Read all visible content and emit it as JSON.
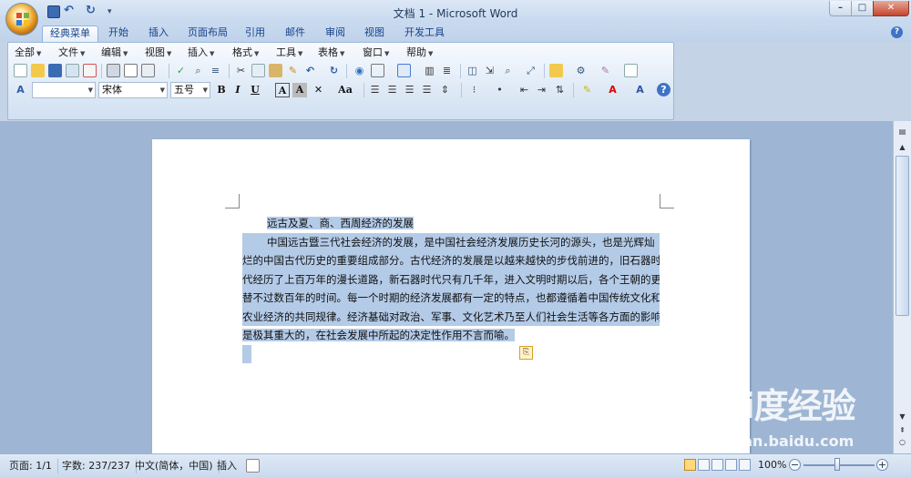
{
  "window": {
    "title": "文档 1 - Microsoft Word",
    "minimize": "–",
    "maximize": "□",
    "close": "✕"
  },
  "quick_access": {
    "undo": "↶",
    "redo": "↻",
    "more": "▾"
  },
  "tabs": [
    {
      "label": "经典菜单",
      "active": true
    },
    {
      "label": "开始"
    },
    {
      "label": "插入"
    },
    {
      "label": "页面布局"
    },
    {
      "label": "引用"
    },
    {
      "label": "邮件"
    },
    {
      "label": "审阅"
    },
    {
      "label": "视图"
    },
    {
      "label": "开发工具"
    }
  ],
  "menus": [
    "全部",
    "文件",
    "编辑",
    "视图",
    "插入",
    "格式",
    "工具",
    "表格",
    "窗口",
    "帮助"
  ],
  "format_bar": {
    "style_value": "",
    "font_name": "宋体",
    "font_size": "五号",
    "bold": "B",
    "italic": "I",
    "underline": "U",
    "char_border": "A",
    "char_shading": "A",
    "change_case": "Aa"
  },
  "document": {
    "title_line": "远古及夏、商、西周经济的发展",
    "lines": [
      "中国远古暨三代社会经济的发展，是中国社会经济发展历史长河的源头，也是光辉灿",
      "烂的中国古代历史的重要组成部分。古代经济的发展是以越来越快的步伐前进的，旧石器时",
      "代经历了上百万年的漫长道路，新石器时代只有几千年，进入文明时期以后，各个王朝的更",
      "替不过数百年的时间。每一个时期的经济发展都有一定的特点，也都遵循着中国传统文化和",
      "农业经济的共同规律。经济基础对政治、军事、文化艺术乃至人们社会生活等各方面的影响",
      "是极其重大的，在社会发展中所起的决定性作用不言而喻。"
    ]
  },
  "status": {
    "page": "页面: 1/1",
    "word_count": "字数: 237/237",
    "language": "中文(简体，中国)",
    "mode": "插入",
    "zoom": "100%"
  },
  "watermark": {
    "logo": "Bai度经验",
    "url": "jingyan.baidu.com"
  },
  "colors": {
    "selection": "#b4cbe8",
    "ribbon_text": "#15428b"
  }
}
